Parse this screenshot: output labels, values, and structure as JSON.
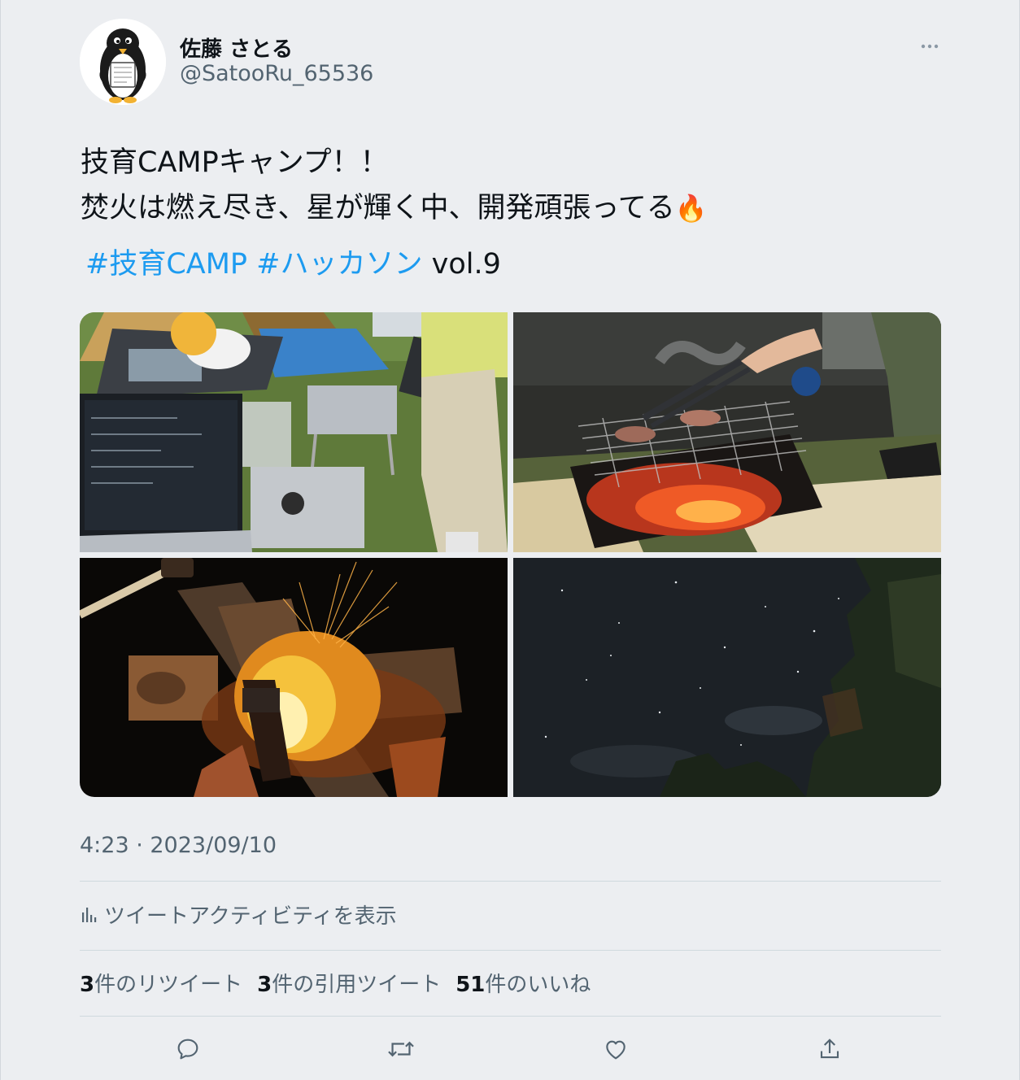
{
  "user": {
    "display_name": "佐藤 さとる",
    "handle": "@SatooRu_65536",
    "avatar_icon": "penguin-avatar"
  },
  "tweet": {
    "lines": [
      "技育CAMPキャンプ！！",
      "焚火は燃え尽き、星が輝く中、開発頑張ってる"
    ],
    "emoji": "🔥",
    "hashtags": [
      "#技育CAMP",
      "#ハッカソン"
    ],
    "hashtag_suffix": "vol.9",
    "timestamp": "4:23 · 2023/09/10"
  },
  "activity": {
    "label": "ツイートアクティビティを表示",
    "icon": "bar-chart-icon"
  },
  "stats": [
    {
      "count": "3",
      "label": "件のリツイート"
    },
    {
      "count": "3",
      "label": "件の引用ツイート"
    },
    {
      "count": "51",
      "label": "件のいいね"
    }
  ],
  "actions": [
    {
      "name": "reply",
      "icon": "reply-icon"
    },
    {
      "name": "retweet",
      "icon": "retweet-icon"
    },
    {
      "name": "like",
      "icon": "heart-icon"
    },
    {
      "name": "share",
      "icon": "share-icon"
    }
  ],
  "media": [
    {
      "subject": "laptops on picnic mat at campsite"
    },
    {
      "subject": "meat grilling over charcoal"
    },
    {
      "subject": "campfire with sparks"
    },
    {
      "subject": "starry night sky over trees"
    }
  ],
  "colors": {
    "background": "#eceef1",
    "text": "#0f1419",
    "secondary": "#536471",
    "link": "#1d9bf0",
    "divider": "#cfd9de"
  }
}
